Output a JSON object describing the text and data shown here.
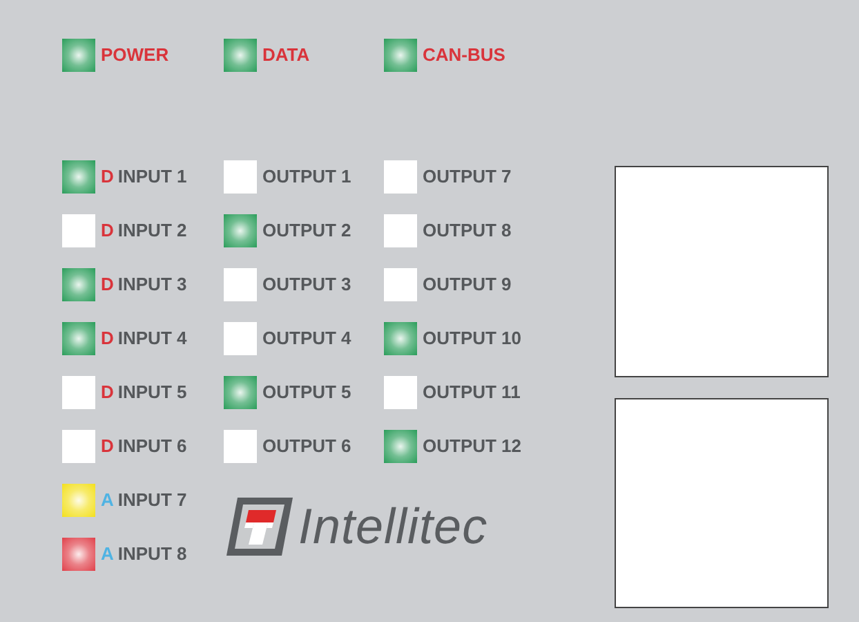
{
  "status_lights": [
    {
      "label": "POWER",
      "on": true,
      "color": "#2a9d5a"
    },
    {
      "label": "DATA",
      "on": true,
      "color": "#2a9d5a"
    },
    {
      "label": "CAN-BUS",
      "on": true,
      "color": "#2a9d5a"
    }
  ],
  "inputs": [
    {
      "prefix": "D",
      "kind": "digital",
      "label": "INPUT 1",
      "on": true,
      "color": "#2a9d5a"
    },
    {
      "prefix": "D",
      "kind": "digital",
      "label": "INPUT 2",
      "on": false
    },
    {
      "prefix": "D",
      "kind": "digital",
      "label": "INPUT 3",
      "on": true,
      "color": "#2a9d5a"
    },
    {
      "prefix": "D",
      "kind": "digital",
      "label": "INPUT 4",
      "on": true,
      "color": "#2a9d5a"
    },
    {
      "prefix": "D",
      "kind": "digital",
      "label": "INPUT 5",
      "on": false
    },
    {
      "prefix": "D",
      "kind": "digital",
      "label": "INPUT 6",
      "on": false
    },
    {
      "prefix": "A",
      "kind": "analog",
      "label": "INPUT 7",
      "on": true,
      "color": "#f3e01c"
    },
    {
      "prefix": "A",
      "kind": "analog",
      "label": "INPUT 8",
      "on": true,
      "color": "#e0404a"
    }
  ],
  "outputs": [
    {
      "label": "OUTPUT 1",
      "on": false
    },
    {
      "label": "OUTPUT 2",
      "on": true,
      "color": "#2a9d5a"
    },
    {
      "label": "OUTPUT 3",
      "on": false
    },
    {
      "label": "OUTPUT 4",
      "on": false
    },
    {
      "label": "OUTPUT 5",
      "on": true,
      "color": "#2a9d5a"
    },
    {
      "label": "OUTPUT 6",
      "on": false
    },
    {
      "label": "OUTPUT 7",
      "on": false
    },
    {
      "label": "OUTPUT 8",
      "on": false
    },
    {
      "label": "OUTPUT 9",
      "on": false
    },
    {
      "label": "OUTPUT 10",
      "on": true,
      "color": "#2a9d5a"
    },
    {
      "label": "OUTPUT 11",
      "on": false
    },
    {
      "label": "OUTPUT 12",
      "on": true,
      "color": "#2a9d5a"
    }
  ],
  "logo": {
    "text": "Intellitec"
  },
  "panels": [
    {
      "kind": "blank"
    },
    {
      "kind": "blank"
    }
  ]
}
